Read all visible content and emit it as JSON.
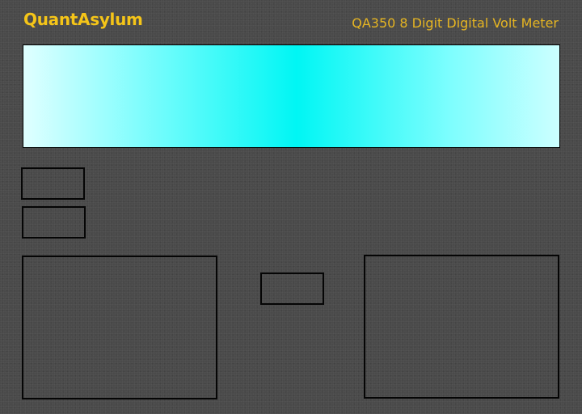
{
  "header": {
    "brand": "QuantAsylum",
    "product_title": "QA350 8 Digit Digital Volt Meter"
  },
  "display": {
    "reading": ""
  },
  "controls": {
    "button_a_label": "",
    "button_b_label": "",
    "button_c_label": ""
  },
  "colors": {
    "brand_text": "#f5c518",
    "title_text": "#e6b522",
    "display_center": "#00f6f4",
    "display_edge": "#e0ffff",
    "background": "#4a4a4a"
  }
}
